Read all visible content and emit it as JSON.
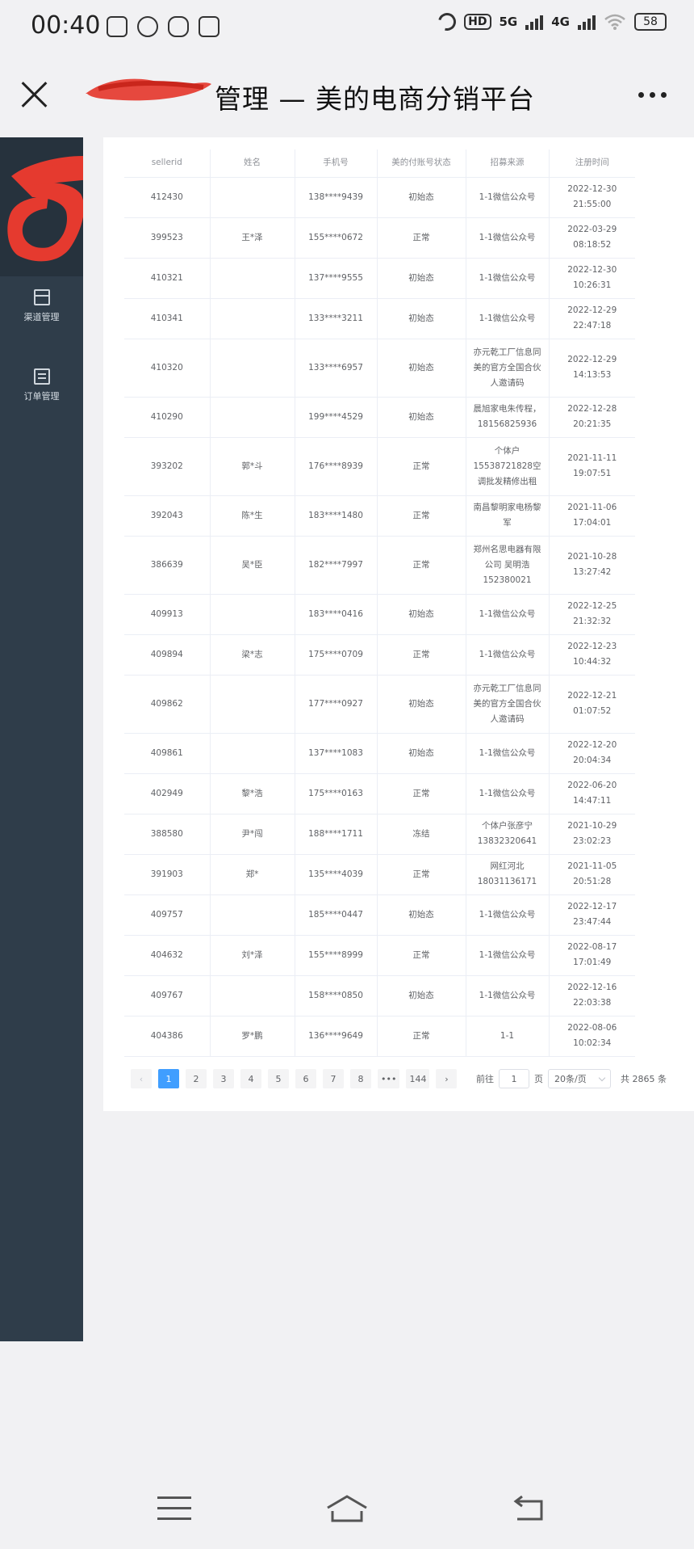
{
  "status_bar": {
    "time": "00:40",
    "hd_label": "HD",
    "net_5g": "5G",
    "net_4g": "4G",
    "battery": "58"
  },
  "title_bar": {
    "title_visible": "管理 — 美的电商分销平台"
  },
  "sidebar": {
    "items": [
      {
        "label": "渠道管理",
        "icon": "shop-icon"
      },
      {
        "label": "订单管理",
        "icon": "list-icon"
      }
    ]
  },
  "table": {
    "headers": [
      "sellerid",
      "姓名",
      "手机号",
      "美的付账号状态",
      "招募来源",
      "注册时间"
    ],
    "rows": [
      [
        "412430",
        "",
        "138****9439",
        "初始态",
        "1-1微信公众号",
        "2022-12-30 21:55:00"
      ],
      [
        "399523",
        "王*泽",
        "155****0672",
        "正常",
        "1-1微信公众号",
        "2022-03-29 08:18:52"
      ],
      [
        "410321",
        "",
        "137****9555",
        "初始态",
        "1-1微信公众号",
        "2022-12-30 10:26:31"
      ],
      [
        "410341",
        "",
        "133****3211",
        "初始态",
        "1-1微信公众号",
        "2022-12-29 22:47:18"
      ],
      [
        "410320",
        "",
        "133****6957",
        "初始态",
        "亦元乾工厂信息同美的官方全国合伙人邀请码",
        "2022-12-29 14:13:53"
      ],
      [
        "410290",
        "",
        "199****4529",
        "初始态",
        "晨旭家电朱传程，18156825936",
        "2022-12-28 20:21:35"
      ],
      [
        "393202",
        "郭*斗",
        "176****8939",
        "正常",
        "个体户15538721828空调批发精修出租",
        "2021-11-11 19:07:51"
      ],
      [
        "392043",
        "陈*生",
        "183****1480",
        "正常",
        "南昌黎明家电杨黎军",
        "2021-11-06 17:04:01"
      ],
      [
        "386639",
        "吴*臣",
        "182****7997",
        "正常",
        "郑州名思电器有限公司 吴明浩 152380021",
        "2021-10-28 13:27:42"
      ],
      [
        "409913",
        "",
        "183****0416",
        "初始态",
        "1-1微信公众号",
        "2022-12-25 21:32:32"
      ],
      [
        "409894",
        "梁*志",
        "175****0709",
        "正常",
        "1-1微信公众号",
        "2022-12-23 10:44:32"
      ],
      [
        "409862",
        "",
        "177****0927",
        "初始态",
        "亦元乾工厂信息同美的官方全国合伙人邀请码",
        "2022-12-21 01:07:52"
      ],
      [
        "409861",
        "",
        "137****1083",
        "初始态",
        "1-1微信公众号",
        "2022-12-20 20:04:34"
      ],
      [
        "402949",
        "黎*浩",
        "175****0163",
        "正常",
        "1-1微信公众号",
        "2022-06-20 14:47:11"
      ],
      [
        "388580",
        "尹*闯",
        "188****1711",
        "冻结",
        "个体户张彦宁13832320641",
        "2021-10-29 23:02:23"
      ],
      [
        "391903",
        "郑*",
        "135****4039",
        "正常",
        "网红河北18031136171",
        "2021-11-05 20:51:28"
      ],
      [
        "409757",
        "",
        "185****0447",
        "初始态",
        "1-1微信公众号",
        "2022-12-17 23:47:44"
      ],
      [
        "404632",
        "刘*泽",
        "155****8999",
        "正常",
        "1-1微信公众号",
        "2022-08-17 17:01:49"
      ],
      [
        "409767",
        "",
        "158****0850",
        "初始态",
        "1-1微信公众号",
        "2022-12-16 22:03:38"
      ],
      [
        "404386",
        "罗*鹏",
        "136****9649",
        "正常",
        "1-1",
        "2022-08-06 10:02:34"
      ]
    ]
  },
  "pagination": {
    "prev": "‹",
    "next": "›",
    "pages": [
      "1",
      "2",
      "3",
      "4",
      "5",
      "6",
      "7",
      "8",
      "•••",
      "144"
    ],
    "current": "1",
    "goto_prefix": "前往",
    "goto_value": "1",
    "goto_suffix": "页",
    "page_size": "20条/页",
    "total": "共 2865 条"
  },
  "colors": {
    "sidebar": "#2f3d4a",
    "accent": "#409eff",
    "scribble": "#e53a2f"
  }
}
